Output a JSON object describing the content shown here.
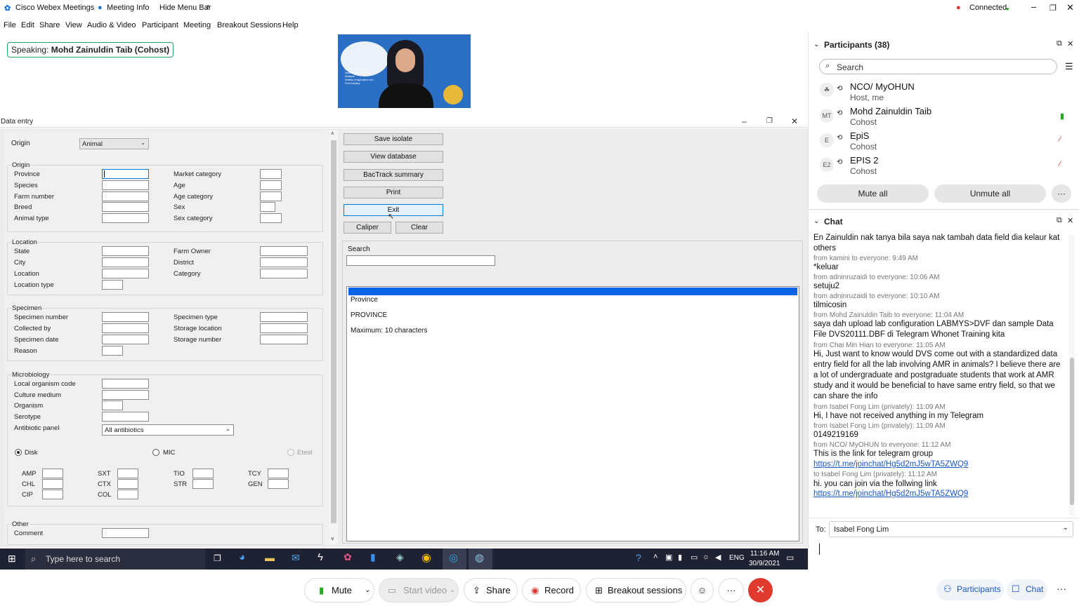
{
  "titlebar": {
    "app_title": "Cisco Webex Meetings",
    "meeting_info": "Meeting Info",
    "hide_menu_bar": "Hide Menu Bar",
    "connection_status": "Connected"
  },
  "menu": [
    "File",
    "Edit",
    "Share",
    "View",
    "Audio & Video",
    "Participant",
    "Meeting",
    "Breakout Sessions",
    "Help"
  ],
  "speaking": {
    "prefix": "Speaking:",
    "name": "Mohd Zainuldin Taib (Cohost)"
  },
  "video_tile": {
    "caption_lines": [
      "Raja Yusra Wahanan",
      "Department of Fisheries",
      "Malaysia",
      "Ministry of Agriculture and",
      "Food Industry"
    ]
  },
  "data_entry": {
    "window_title": "Data entry",
    "origin_label": "Origin",
    "origin_value": "Animal",
    "groups": {
      "origin": "Origin",
      "location": "Location",
      "specimen": "Specimen",
      "microbiology": "Microbiology",
      "other": "Other"
    },
    "origin_fields_left": [
      "Province",
      "Species",
      "Farm number",
      "Breed",
      "Animal type"
    ],
    "origin_fields_right": [
      "Market category",
      "Age",
      "Age category",
      "Sex",
      "Sex category"
    ],
    "location_fields_left": [
      "State",
      "City",
      "Location",
      "Location type"
    ],
    "location_fields_right": [
      "Farm Owner",
      "District",
      "Category"
    ],
    "specimen_fields_left": [
      "Specimen number",
      "Collected by",
      "Specimen date",
      "Reason"
    ],
    "specimen_fields_right": [
      "Specimen type",
      "Storage location",
      "Storage number"
    ],
    "micro_fields": [
      "Local organism code",
      "Culture medium",
      "Organism",
      "Serotype",
      "Antibiotic panel"
    ],
    "antibiotic_panel_value": "All antibiotics",
    "test_methods": {
      "disk": "Disk",
      "mic": "MIC",
      "etest": "Etest"
    },
    "antibiotics": [
      [
        "AMP",
        "SXT",
        "TIO",
        "TCY"
      ],
      [
        "CHL",
        "CTX",
        "STR",
        "GEN"
      ],
      [
        "CIP",
        "COL"
      ]
    ],
    "other_fields": [
      "Comment"
    ],
    "buttons": {
      "save_isolate": "Save isolate",
      "view_database": "View database",
      "bactrack_summary": "BacTrack summary",
      "print": "Print",
      "exit": "Exit",
      "caliper": "Caliper",
      "clear": "Clear"
    },
    "search_label": "Search",
    "help_box": {
      "field_name": "Province",
      "field_code": "PROVINCE",
      "max_info": "Maximum:  10 characters"
    }
  },
  "participants": {
    "header": "Participants (38)",
    "search_placeholder": "Search",
    "list": [
      {
        "initials": "",
        "name": "NCO/ MyOHUN",
        "role": "Host, me"
      },
      {
        "initials": "MT",
        "name": "Mohd Zainuldin Taib",
        "role": "Cohost"
      },
      {
        "initials": "E",
        "name": "EpiS",
        "role": "Cohost"
      },
      {
        "initials": "E2",
        "name": "EPIS 2",
        "role": "Cohost"
      }
    ],
    "mute_all": "Mute all",
    "unmute_all": "Unmute all"
  },
  "chat": {
    "header": "Chat",
    "items": [
      {
        "type": "msg",
        "text": "En Zainuldin nak tanya bila saya nak tambah data field dia kelaur kat others"
      },
      {
        "type": "meta",
        "text": "from kamini to everyone:   9:49 AM"
      },
      {
        "type": "msg",
        "text": "*keluar"
      },
      {
        "type": "meta",
        "text": "from adninruzaidi to everyone:   10:06 AM"
      },
      {
        "type": "msg",
        "text": "setuju2"
      },
      {
        "type": "meta",
        "text": "from adninruzaidi to everyone:   10:10 AM"
      },
      {
        "type": "msg",
        "text": "tilmicosin"
      },
      {
        "type": "meta",
        "text": "from Mohd Zainuldin Taib to everyone:   11:04 AM"
      },
      {
        "type": "msg",
        "text": "saya dah upload lab configuration LABMYS>DVF dan sample Data File DVS20111.DBF di Telegram Whonet Training kita"
      },
      {
        "type": "meta",
        "text": "from Chai Min Hian to everyone:   11:05 AM"
      },
      {
        "type": "msg",
        "text": "Hi, Just want to know would DVS come out with a standardized data entry field for all the lab involving AMR in animals? I believe there are a lot of undergraduate and postgraduate students that work at AMR study and it would be beneficial to have same entry field, so that we can share the info"
      },
      {
        "type": "meta",
        "text": "from Isabel Fong Lim (privately):   11:09 AM"
      },
      {
        "type": "msg",
        "text": "Hi, I have not received anything in my Telegram"
      },
      {
        "type": "meta",
        "text": "from Isabel Fong Lim (privately):   11:09 AM"
      },
      {
        "type": "msg",
        "text": "0149219169"
      },
      {
        "type": "meta",
        "text": "from NCO/ MyOHUN to everyone:   11:12 AM"
      },
      {
        "type": "msg",
        "text": "This is the link for telegram group"
      },
      {
        "type": "link",
        "text": "https://t.me/joinchat/Hg5d2mJ5wTA5ZWQ9"
      },
      {
        "type": "meta",
        "text": "to Isabel Fong Lim (privately):   11:12 AM"
      },
      {
        "type": "msg",
        "text": "hi. you can join via the follwing link"
      },
      {
        "type": "link",
        "text": "https://t.me/joinchat/Hg5d2mJ5wTA5ZWQ9"
      }
    ],
    "to_label": "To:",
    "to_value": "Isabel Fong Lim"
  },
  "taskbar": {
    "search_placeholder": "Type here to search",
    "lang": "ENG",
    "time": "11:16 AM",
    "date": "30/9/2021"
  },
  "controls": {
    "mute": "Mute",
    "start_video": "Start video",
    "share": "Share",
    "record": "Record",
    "breakout": "Breakout sessions",
    "participants": "Participants",
    "chat": "Chat"
  },
  "colors": {
    "accent": "#0a64e8",
    "end_call": "#e03a2f",
    "link": "#1a56c8"
  }
}
